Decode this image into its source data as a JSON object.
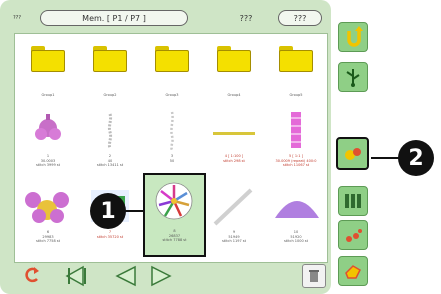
{
  "header": {
    "left_tag": "???",
    "title": "Mem. [ P1 / P7 ]",
    "middle_text": "???",
    "right_pill": "???"
  },
  "grid": {
    "folders": [
      {
        "label": "Group1"
      },
      {
        "label": "Group2"
      },
      {
        "label": "Group3"
      },
      {
        "label": "Group4"
      },
      {
        "label": "Group5"
      }
    ],
    "row2": [
      {
        "caption": "1\n30.0003\nstitch 3999 st"
      },
      {
        "caption": "2\n40\nstitch 13411 st"
      },
      {
        "caption": "3\n50"
      },
      {
        "caption": "4 [ 1:100 ]\nstitch 298 st"
      },
      {
        "caption": "5 [ 1:1 ]\n30.0009 (repeat) 400:0\nstitch 11067 st"
      }
    ],
    "row3": [
      {
        "caption": "6\n29983\nstitch 7758 st"
      },
      {
        "caption": "7\nstitch 35720 st"
      },
      {
        "caption": "8\n26837\nstitch 7788 st"
      },
      {
        "caption": "9\n51949\nstitch 1197 st"
      },
      {
        "caption": "10\n51920\nstitch 1000 st"
      }
    ]
  },
  "callouts": {
    "one": "1",
    "two": "2"
  },
  "colors": {
    "panel_bg": "#cfe5c6",
    "sidebar_btn": "#8fcf86",
    "folder_yellow": "#f4e000",
    "selection_bg": "#c8e8c0"
  },
  "icons": {
    "sidebar": [
      "u-turn-arrow-icon",
      "usb-icon",
      "embroidery-move-icon",
      "thread-spools-icon",
      "sewing-machine-icon",
      "hand-icon"
    ],
    "bottom": [
      "back-arrow-icon",
      "first-page-icon",
      "prev-page-icon",
      "next-page-icon",
      "delete-icon"
    ]
  }
}
